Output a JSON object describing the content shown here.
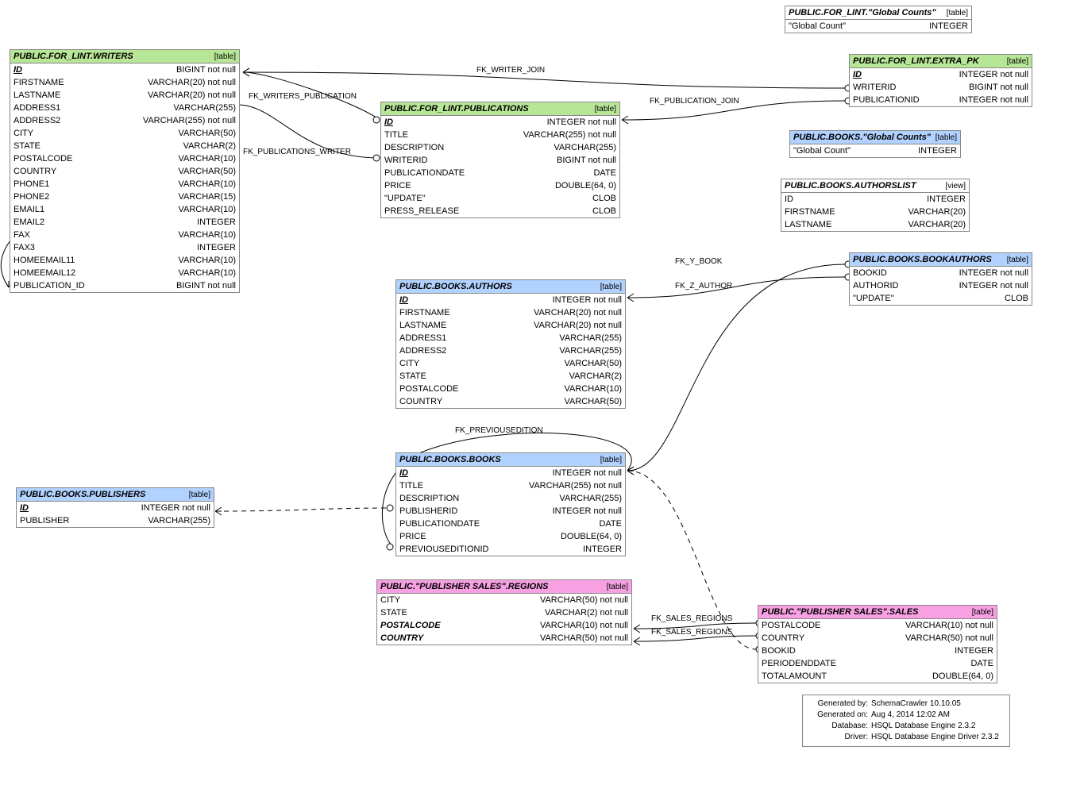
{
  "colors": {
    "green": "#b7e697",
    "blue": "#b1d1ff",
    "pink": "#f7a1e3"
  },
  "tables": {
    "writers": {
      "title": "PUBLIC.FOR_LINT.WRITERS",
      "kind": "[table]",
      "color": "green",
      "cols": [
        {
          "n": "ID",
          "t": "BIGINT not null",
          "pk": true
        },
        {
          "n": "FIRSTNAME",
          "t": "VARCHAR(20) not null"
        },
        {
          "n": "LASTNAME",
          "t": "VARCHAR(20) not null"
        },
        {
          "n": "ADDRESS1",
          "t": "VARCHAR(255)"
        },
        {
          "n": "ADDRESS2",
          "t": "VARCHAR(255) not null"
        },
        {
          "n": "CITY",
          "t": "VARCHAR(50)"
        },
        {
          "n": "STATE",
          "t": "VARCHAR(2)"
        },
        {
          "n": "POSTALCODE",
          "t": "VARCHAR(10)"
        },
        {
          "n": "COUNTRY",
          "t": "VARCHAR(50)"
        },
        {
          "n": "PHONE1",
          "t": "VARCHAR(10)"
        },
        {
          "n": "PHONE2",
          "t": "VARCHAR(15)"
        },
        {
          "n": "EMAIL1",
          "t": "VARCHAR(10)"
        },
        {
          "n": "EMAIL2",
          "t": "INTEGER"
        },
        {
          "n": "FAX",
          "t": "VARCHAR(10)"
        },
        {
          "n": "FAX3",
          "t": "INTEGER"
        },
        {
          "n": "HOMEEMAIL11",
          "t": "VARCHAR(10)"
        },
        {
          "n": "HOMEEMAIL12",
          "t": "VARCHAR(10)"
        },
        {
          "n": "PUBLICATION_ID",
          "t": "BIGINT not null"
        }
      ]
    },
    "publications": {
      "title": "PUBLIC.FOR_LINT.PUBLICATIONS",
      "kind": "[table]",
      "color": "green",
      "cols": [
        {
          "n": "ID",
          "t": "INTEGER not null",
          "pk": true
        },
        {
          "n": "TITLE",
          "t": "VARCHAR(255) not null"
        },
        {
          "n": "DESCRIPTION",
          "t": "VARCHAR(255)"
        },
        {
          "n": "WRITERID",
          "t": "BIGINT not null"
        },
        {
          "n": "PUBLICATIONDATE",
          "t": "DATE"
        },
        {
          "n": "PRICE",
          "t": "DOUBLE(64, 0)"
        },
        {
          "n": "\"UPDATE\"",
          "t": "CLOB"
        },
        {
          "n": "PRESS_RELEASE",
          "t": "CLOB"
        }
      ]
    },
    "extra_pk": {
      "title": "PUBLIC.FOR_LINT.EXTRA_PK",
      "kind": "[table]",
      "color": "green",
      "cols": [
        {
          "n": "ID",
          "t": "INTEGER not null",
          "pk": true
        },
        {
          "n": "WRITERID",
          "t": "BIGINT not null"
        },
        {
          "n": "PUBLICATIONID",
          "t": "INTEGER not null"
        }
      ]
    },
    "global_counts_lint": {
      "title": "PUBLIC.FOR_LINT.\"Global Counts\"",
      "kind": "[table]",
      "color": "white",
      "cols": [
        {
          "n": "\"Global Count\"",
          "t": "INTEGER"
        }
      ]
    },
    "global_counts_books": {
      "title": "PUBLIC.BOOKS.\"Global Counts\"",
      "kind": "[table]",
      "color": "blue",
      "cols": [
        {
          "n": "\"Global Count\"",
          "t": "INTEGER"
        }
      ]
    },
    "authorslist": {
      "title": "PUBLIC.BOOKS.AUTHORSLIST",
      "kind": "[view]",
      "color": "white",
      "cols": [
        {
          "n": "ID",
          "t": "INTEGER"
        },
        {
          "n": "FIRSTNAME",
          "t": "VARCHAR(20)"
        },
        {
          "n": "LASTNAME",
          "t": "VARCHAR(20)"
        }
      ]
    },
    "bookauthors": {
      "title": "PUBLIC.BOOKS.BOOKAUTHORS",
      "kind": "[table]",
      "color": "blue",
      "cols": [
        {
          "n": "BOOKID",
          "t": "INTEGER not null"
        },
        {
          "n": "AUTHORID",
          "t": "INTEGER not null"
        },
        {
          "n": "\"UPDATE\"",
          "t": "CLOB"
        }
      ]
    },
    "authors": {
      "title": "PUBLIC.BOOKS.AUTHORS",
      "kind": "[table]",
      "color": "blue",
      "cols": [
        {
          "n": "ID",
          "t": "INTEGER not null",
          "pk": true
        },
        {
          "n": "FIRSTNAME",
          "t": "VARCHAR(20) not null"
        },
        {
          "n": "LASTNAME",
          "t": "VARCHAR(20) not null"
        },
        {
          "n": "ADDRESS1",
          "t": "VARCHAR(255)"
        },
        {
          "n": "ADDRESS2",
          "t": "VARCHAR(255)"
        },
        {
          "n": "CITY",
          "t": "VARCHAR(50)"
        },
        {
          "n": "STATE",
          "t": "VARCHAR(2)"
        },
        {
          "n": "POSTALCODE",
          "t": "VARCHAR(10)"
        },
        {
          "n": "COUNTRY",
          "t": "VARCHAR(50)"
        }
      ]
    },
    "books": {
      "title": "PUBLIC.BOOKS.BOOKS",
      "kind": "[table]",
      "color": "blue",
      "cols": [
        {
          "n": "ID",
          "t": "INTEGER not null",
          "pk": true
        },
        {
          "n": "TITLE",
          "t": "VARCHAR(255) not null"
        },
        {
          "n": "DESCRIPTION",
          "t": "VARCHAR(255)"
        },
        {
          "n": "PUBLISHERID",
          "t": "INTEGER not null"
        },
        {
          "n": "PUBLICATIONDATE",
          "t": "DATE"
        },
        {
          "n": "PRICE",
          "t": "DOUBLE(64, 0)"
        },
        {
          "n": "PREVIOUSEDITIONID",
          "t": "INTEGER"
        }
      ]
    },
    "publishers": {
      "title": "PUBLIC.BOOKS.PUBLISHERS",
      "kind": "[table]",
      "color": "blue",
      "cols": [
        {
          "n": "ID",
          "t": "INTEGER not null",
          "pk": true
        },
        {
          "n": "PUBLISHER",
          "t": "VARCHAR(255)"
        }
      ]
    },
    "regions": {
      "title": "PUBLIC.\"PUBLISHER SALES\".REGIONS",
      "kind": "[table]",
      "color": "pink",
      "cols": [
        {
          "n": "CITY",
          "t": "VARCHAR(50) not null"
        },
        {
          "n": "STATE",
          "t": "VARCHAR(2) not null"
        },
        {
          "n": "POSTALCODE",
          "t": "VARCHAR(10) not null",
          "fk": true
        },
        {
          "n": "COUNTRY",
          "t": "VARCHAR(50) not null",
          "fk": true
        }
      ]
    },
    "sales": {
      "title": "PUBLIC.\"PUBLISHER SALES\".SALES",
      "kind": "[table]",
      "color": "pink",
      "cols": [
        {
          "n": "POSTALCODE",
          "t": "VARCHAR(10) not null"
        },
        {
          "n": "COUNTRY",
          "t": "VARCHAR(50) not null"
        },
        {
          "n": "BOOKID",
          "t": "INTEGER"
        },
        {
          "n": "PERIODENDDATE",
          "t": "DATE"
        },
        {
          "n": "TOTALAMOUNT",
          "t": "DOUBLE(64, 0)"
        }
      ]
    }
  },
  "fk_labels": {
    "writer_join": "FK_WRITER_JOIN",
    "writers_publication": "FK_WRITERS_PUBLICATION",
    "publications_writer": "FK_PUBLICATIONS_WRITER",
    "publication_join": "FK_PUBLICATION_JOIN",
    "y_book": "FK_Y_BOOK",
    "z_author": "FK_Z_AUTHOR",
    "previousedition": "FK_PREVIOUSEDITION",
    "sales_regions": "FK_SALES_REGIONS",
    "sales_regions2": "FK_SALES_REGIONS"
  },
  "meta": {
    "gen_by_label": "Generated by:",
    "gen_by": "SchemaCrawler 10.10.05",
    "gen_on_label": "Generated on:",
    "gen_on": "Aug 4, 2014 12:02 AM",
    "db_label": "Database:",
    "db": "HSQL Database Engine  2.3.2",
    "drv_label": "Driver:",
    "drv": "HSQL Database Engine Driver  2.3.2"
  }
}
